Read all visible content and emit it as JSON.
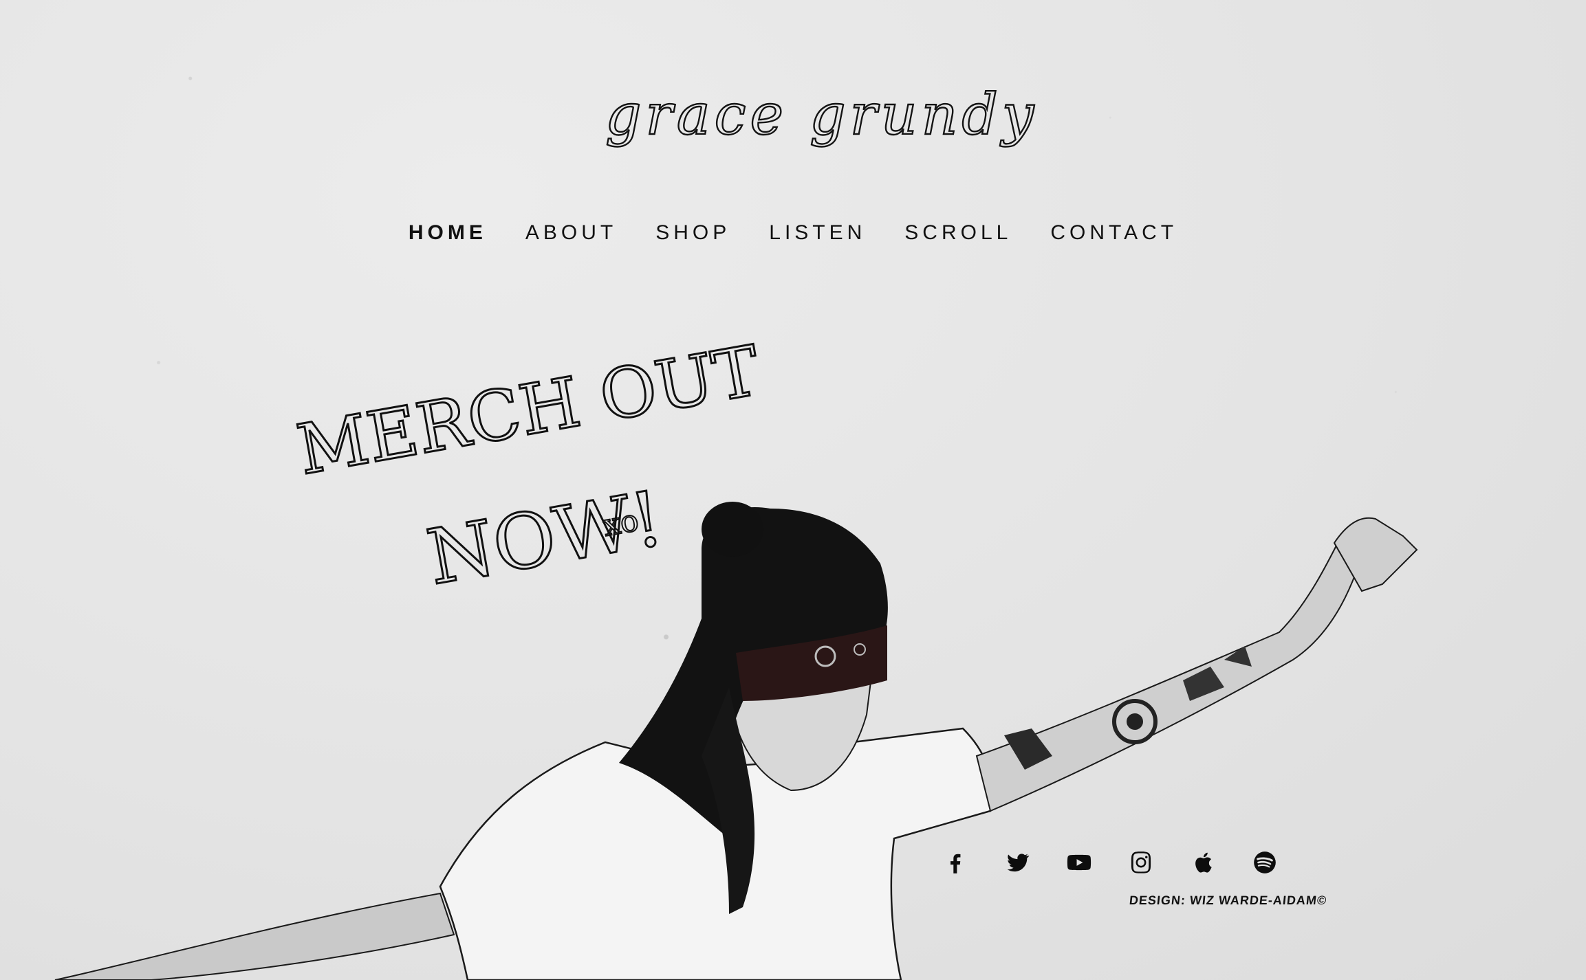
{
  "site": {
    "logo_text": "grace grundy"
  },
  "nav": {
    "items": [
      {
        "label": "HOME",
        "active": true
      },
      {
        "label": "ABOUT",
        "active": false
      },
      {
        "label": "SHOP",
        "active": false
      },
      {
        "label": "LISTEN",
        "active": false
      },
      {
        "label": "SCROLL",
        "active": false
      },
      {
        "label": "CONTACT",
        "active": false
      }
    ]
  },
  "hero": {
    "note_line1": "MERCH OUT",
    "note_line2": "NOW!",
    "note_signoff": "xo"
  },
  "social": {
    "icons": [
      "facebook-icon",
      "twitter-icon",
      "youtube-icon",
      "instagram-icon",
      "apple-music-icon",
      "spotify-icon"
    ]
  },
  "footer": {
    "credit": "DESIGN: WIZ WARDE-AIDAM©"
  },
  "colors": {
    "background": "#e6e6e6",
    "ink": "#111111",
    "bandana": "#2a1616"
  }
}
